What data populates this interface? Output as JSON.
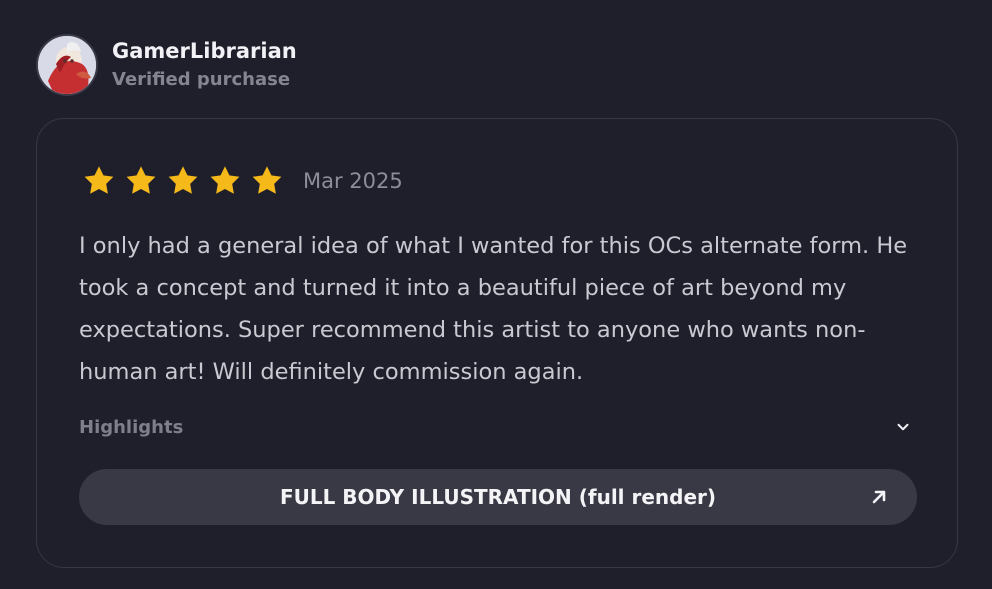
{
  "user": {
    "name": "GamerLibrarian",
    "status": "Verified purchase",
    "avatar_icon": "avatar-illustration-icon"
  },
  "review": {
    "rating": 5,
    "max_rating": 5,
    "star_color": "#f5b91a",
    "date": "Mar 2025",
    "text": "I only had a general idea of what I wanted for this OCs alternate form. He took a concept and turned it into a beautiful piece of art beyond my expectations. Super recommend this artist to anyone who wants non-human art! Will definitely commission again."
  },
  "highlights": {
    "label": "Highlights",
    "toggle_icon": "chevron-down-icon"
  },
  "product": {
    "label": "FULL BODY ILLUSTRATION (full render)",
    "icon": "external-link-arrow-icon"
  }
}
